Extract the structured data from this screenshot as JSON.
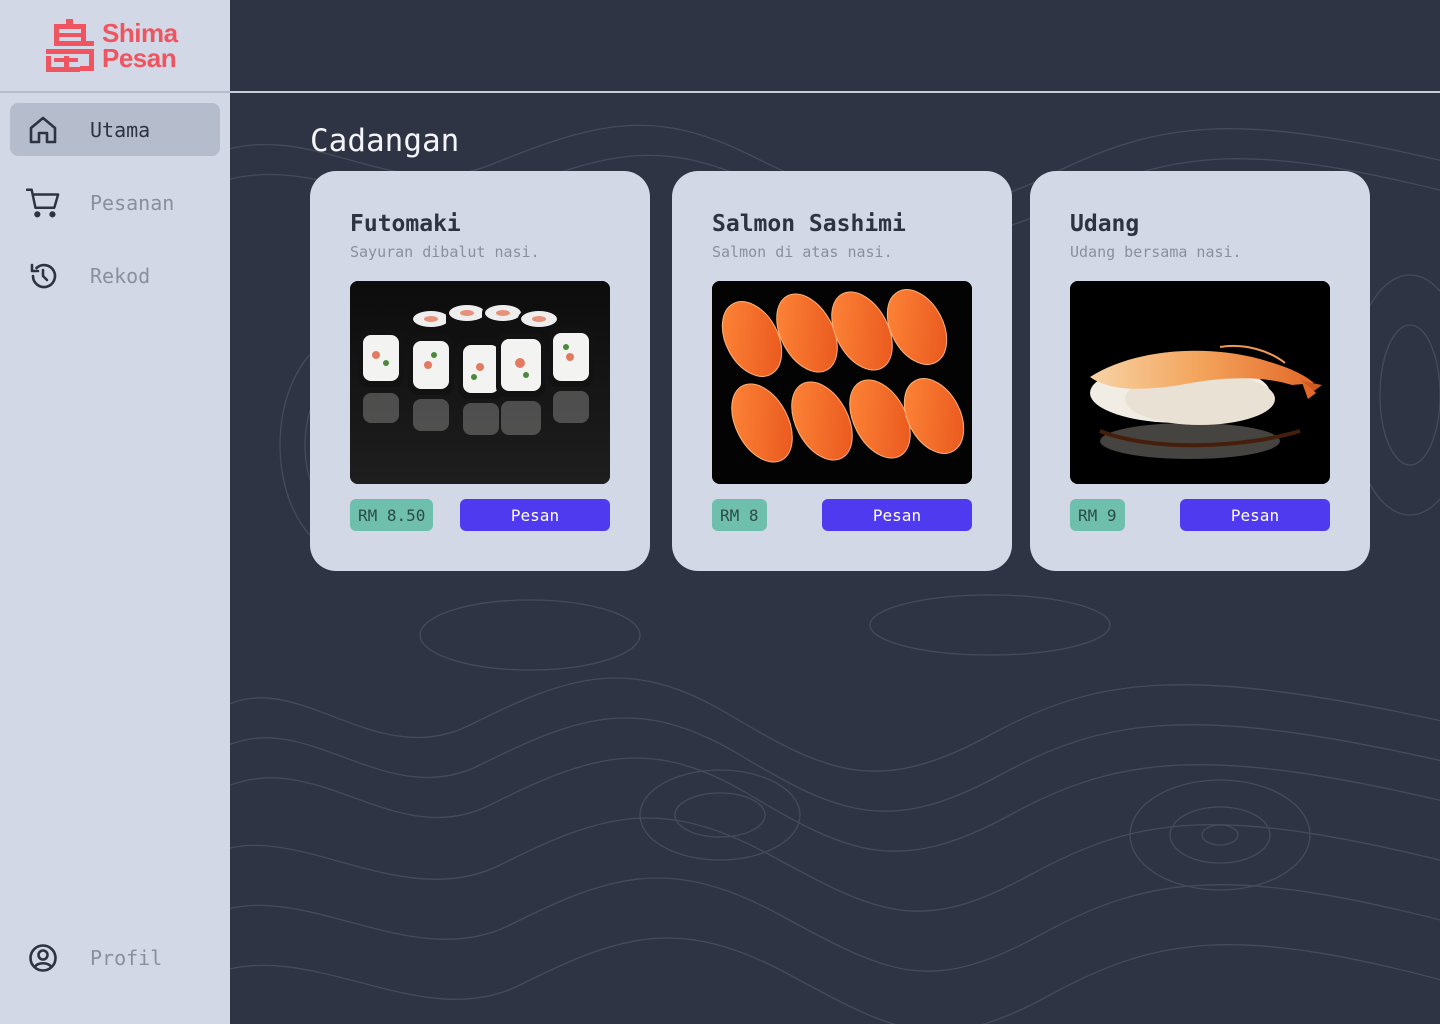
{
  "brand": {
    "name_line1": "Shima",
    "name_line2": "Pesan",
    "color": "#ef5560",
    "icon": "island-kanji-logo"
  },
  "sidebar": {
    "items": [
      {
        "label": "Utama",
        "icon": "home-icon",
        "active": true
      },
      {
        "label": "Pesanan",
        "icon": "cart-icon",
        "active": false
      },
      {
        "label": "Rekod",
        "icon": "history-icon",
        "active": false
      }
    ],
    "profile": {
      "label": "Profil",
      "icon": "user-circle-icon"
    }
  },
  "main": {
    "title": "Cadangan",
    "cards": [
      {
        "name": "Futomaki",
        "description": "Sayuran dibalut nasi.",
        "price": "RM 8.50",
        "button": "Pesan",
        "image": "futomaki-photo"
      },
      {
        "name": "Salmon Sashimi",
        "description": "Salmon di atas nasi.",
        "price": "RM 8",
        "button": "Pesan",
        "image": "salmon-sashimi-photo"
      },
      {
        "name": "Udang",
        "description": "Udang bersama nasi.",
        "price": "RM 9",
        "button": "Pesan",
        "image": "udang-photo"
      }
    ]
  },
  "colors": {
    "background": "#2f3445",
    "sidebar": "#d3d8e6",
    "accent": "#4f3af0",
    "price_badge": "#6fbfad"
  }
}
